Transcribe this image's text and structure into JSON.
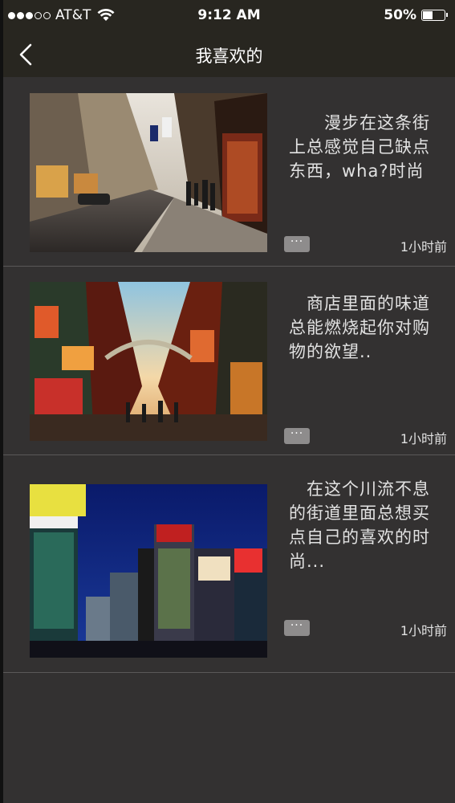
{
  "status_bar": {
    "carrier": "AT&T",
    "signal_icon": "signal-dots-icon",
    "wifi_icon": "wifi-icon",
    "time": "9:12 AM",
    "battery": "50%",
    "battery_level": 0.5
  },
  "nav": {
    "back_icon": "chevron-left-icon",
    "title": "我喜欢的"
  },
  "items": [
    {
      "image_desc": "street-scene-photo",
      "text": "　　漫步在这条街上总感觉自己缺点东西，wha?时尚",
      "more_label": "···",
      "time_ago": "1小时前"
    },
    {
      "image_desc": "shopping-street-arch-photo",
      "text": "　商店里面的味道总能燃烧起你对购物的欲望..",
      "more_label": "···",
      "time_ago": "1小时前"
    },
    {
      "image_desc": "city-night-billboards-photo",
      "text": "　在这个川流不息的街道里面总想买点自己的喜欢的时尚...",
      "more_label": "···",
      "time_ago": "1小时前"
    }
  ]
}
